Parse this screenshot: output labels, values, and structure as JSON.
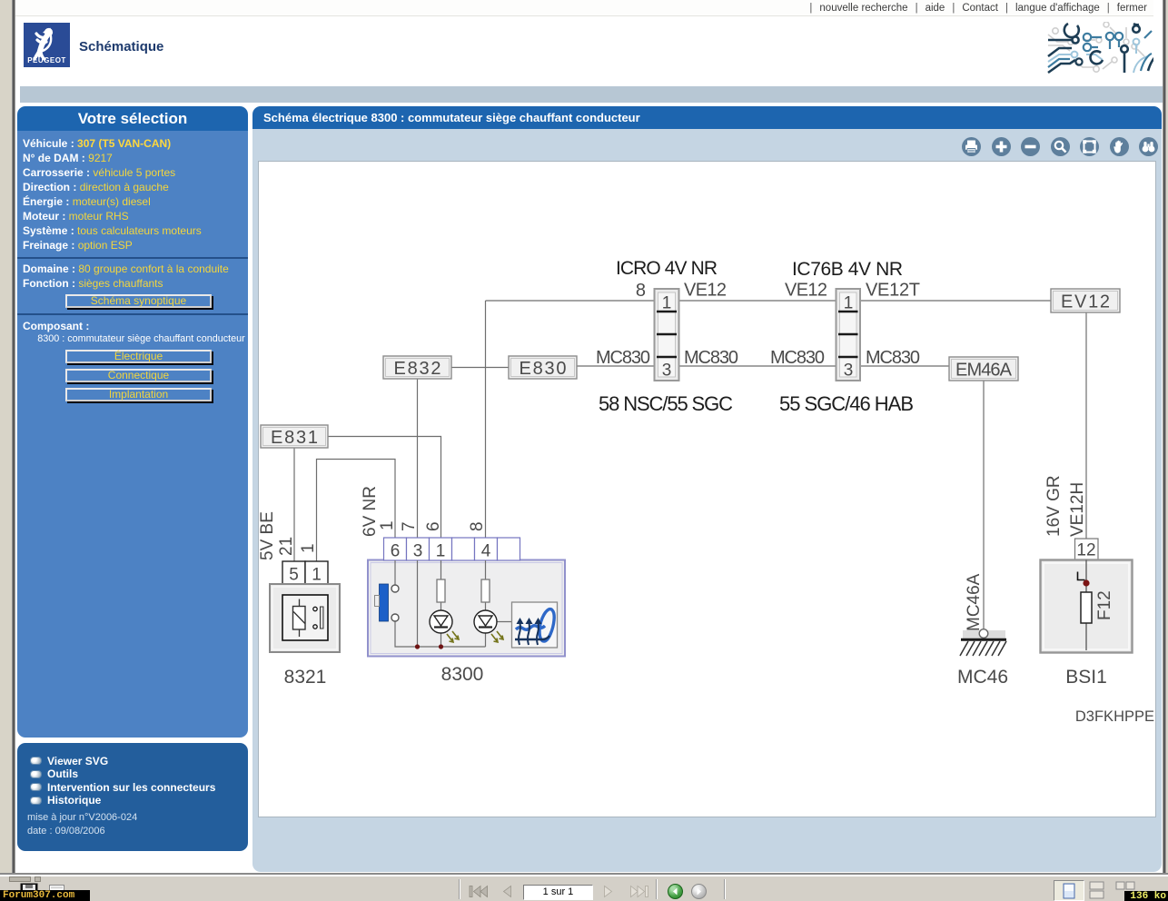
{
  "top_links": {
    "items": [
      "nouvelle recherche",
      "aide",
      "Contact",
      "langue d'affichage",
      "fermer"
    ]
  },
  "brand": {
    "logo_text": "PEUGEOT",
    "app_title": "Schématique"
  },
  "sidebar": {
    "title": "Votre sélection",
    "rows": [
      {
        "label": "Véhicule :",
        "value": "307 (T5 VAN-CAN)"
      },
      {
        "label": "N° de DAM :",
        "value": "9217"
      },
      {
        "label": "Carrosserie :",
        "value": "véhicule 5 portes"
      },
      {
        "label": "Direction :",
        "value": "direction à gauche"
      },
      {
        "label": "Énergie :",
        "value": "moteur(s) diesel"
      },
      {
        "label": "Moteur :",
        "value": "moteur RHS"
      },
      {
        "label": "Système :",
        "value": "tous calculateurs moteurs"
      },
      {
        "label": "Freinage :",
        "value": "option ESP"
      }
    ],
    "domain_rows": [
      {
        "label": "Domaine :",
        "value": "80 groupe confort à la conduite"
      },
      {
        "label": "Fonction :",
        "value": "sièges chauffants"
      }
    ],
    "synoptique_button": "Schéma synoptique",
    "composant_label": "Composant :",
    "composant_value": "8300 : commutateur siège chauffant conducteur",
    "buttons": [
      "Électrique",
      "Connectique",
      "Implantation"
    ],
    "menu": {
      "items": [
        "Viewer SVG",
        "Outils",
        "Intervention sur les connecteurs",
        "Historique"
      ],
      "update_note": "mise à jour n°V2006-024",
      "date_note": "date : 09/08/2006"
    }
  },
  "main": {
    "title": "Schéma électrique 8300 : commutateur siège chauffant conducteur",
    "toolbar_icons": [
      "print",
      "zoom-in",
      "zoom-out",
      "zoom-area",
      "fit",
      "pan",
      "search"
    ]
  },
  "diagram": {
    "boxes": {
      "e832": "E832",
      "e830": "E830",
      "e831": "E831",
      "ev12": "EV12",
      "em46a": "EM46A"
    },
    "icro": {
      "title": "ICRO 4V NR",
      "pin_top": "1",
      "pin_bottom": "3",
      "left_top": "8",
      "right_top": "VE12",
      "left_bottom": "MC830",
      "right_bottom": "MC830",
      "bundle": "58 NSC/55 SGC"
    },
    "ic76b": {
      "title": "IC76B 4V NR",
      "pin_top": "1",
      "pin_bottom": "3",
      "left_top": "VE12",
      "right_top": "VE12T",
      "left_bottom": "MC830",
      "right_bottom": "MC830",
      "bundle": "55 SGC/46 HAB"
    },
    "switch_unit": {
      "label": "8321",
      "pin_a": "5",
      "pin_b": "1",
      "wire_a": "5V BE",
      "wire_a2": "21",
      "wire_b": "1"
    },
    "seat_unit": {
      "label": "8300",
      "pin_1": "6",
      "pin_2": "3",
      "pin_3": "1",
      "pin_4": "",
      "pin_5": "4",
      "pin_6": "",
      "wire_id": "6V NR",
      "lbl_p6": "1",
      "lbl_p3": "7",
      "lbl_p1": "6",
      "lbl_p4": "8"
    },
    "ground": {
      "label": "MC46",
      "wire_label": "MC46A"
    },
    "bsi": {
      "label": "BSI1",
      "pin": "12",
      "fuse": "F12",
      "wire_a": "16V GR",
      "wire_b": "VE12H"
    },
    "ref": "D3FKHPPE"
  },
  "statusbar": {
    "page": "1 sur 1",
    "size": "136 ko",
    "watermark": "Forum307.com"
  }
}
